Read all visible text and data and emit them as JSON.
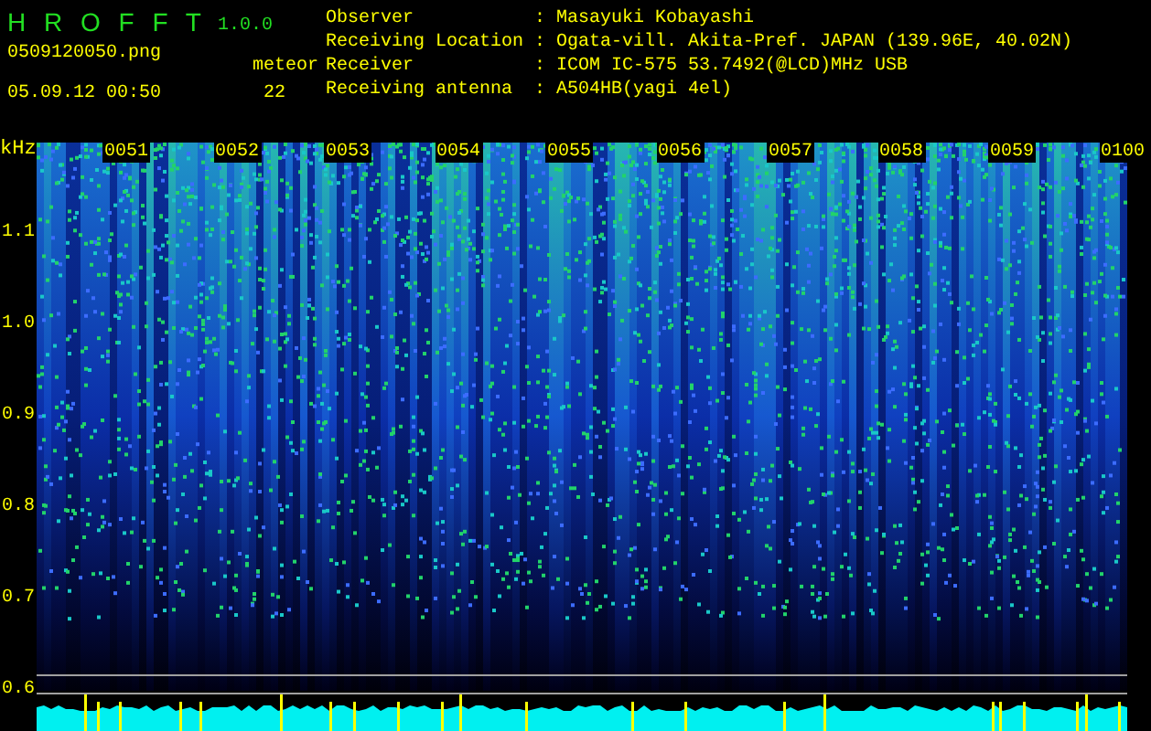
{
  "app": {
    "title": "H R O F F T",
    "version": "1.0.0"
  },
  "file": "0509120050.png",
  "datetime": "05.09.12 00:50",
  "meteor": {
    "label": "meteor",
    "count": "22"
  },
  "info": [
    {
      "label": "Observer",
      "separator": ":",
      "value": "Masayuki Kobayashi"
    },
    {
      "label": "Receiving Location",
      "separator": ":",
      "value": "Ogata-vill. Akita-Pref. JAPAN (139.96E, 40.02N)"
    },
    {
      "label": "Receiver",
      "separator": ":",
      "value": "ICOM IC-575 53.7492(@LCD)MHz USB"
    },
    {
      "label": "Receiving antenna",
      "separator": ":",
      "value": "A504HB(yagi 4el)"
    }
  ],
  "spectrogram": {
    "unit": "kHz",
    "y_labels": [
      "1.1",
      "1.0",
      "0.9",
      "0.8",
      "0.7",
      "0.6"
    ],
    "time_labels": [
      "0051",
      "0052",
      "0053",
      "0054",
      "0055",
      "0056",
      "0057",
      "0058",
      "0059",
      "0100"
    ]
  }
}
